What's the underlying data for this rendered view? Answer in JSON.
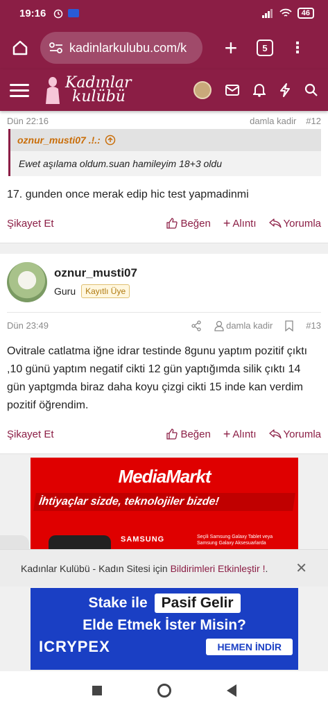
{
  "status_bar": {
    "time": "19:16",
    "battery": "46"
  },
  "browser": {
    "url": "kadinlarkulubu.com/k",
    "tab_count": "5"
  },
  "site": {
    "logo_line1": "Kadınlar",
    "logo_line2": "kulübü"
  },
  "post1": {
    "cut_meta_left": "Dün 22:16",
    "cut_meta_right": "damla kadir",
    "cut_meta_num": "#12",
    "quote_author": "oznur_musti07 .!.:",
    "quote_text": "Ewet aşılama oldum.suan hamileyim 18+3 oldu",
    "text": "17. gunden once merak edip hic test yapmadinmi",
    "report": "Şikayet Et",
    "like": "Beğen",
    "quote": "Alıntı",
    "reply": "Yorumla"
  },
  "post2": {
    "author": "oznur_musti07",
    "role": "Guru",
    "badge": "Kayıtlı Üye",
    "date": "Dün 23:49",
    "user": "damla kadir",
    "num": "#13",
    "text": "Ovitrale catlatma iğne idrar testinde 8gunu yaptım pozitif çıktı ,10 günü yaptım negatif cikti 12 gün yaptığımda silik çıktı 14 gün yaptgmda biraz daha koyu çizgi cikti 15 inde kan verdim pozitif öğrendim.",
    "report": "Şikayet Et",
    "like": "Beğen",
    "quote": "Alıntı",
    "reply": "Yorumla"
  },
  "ad1": {
    "logo": "MediaMarkt",
    "slogan": "İhtiyaçlar sizde, teknolojiler bizde!",
    "brand": "SAMSUNG",
    "fine": "Seçili Samsung Galaxy Tablet veya Samsung Galaxy Aksesuarlarda"
  },
  "notice": {
    "text": "Kadınlar Kulübü - Kadın Sitesi için ",
    "link": "Bildirimleri Etkinleştir !",
    "suffix": "."
  },
  "ad2": {
    "line1a": "Stake ile",
    "line1b": "Pasif Gelir",
    "line2": "Elde Etmek İster Misin?",
    "brand": "ICRYPEX",
    "cta": "HEMEN İNDİR"
  },
  "colors": {
    "brand": "#8b1e45",
    "accent": "#c96e0a",
    "mediamarkt": "#df0000",
    "icrypex": "#1a3fc4"
  }
}
